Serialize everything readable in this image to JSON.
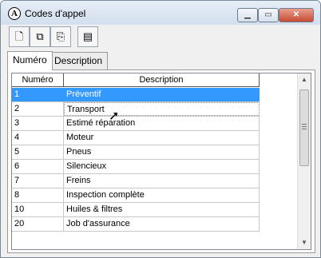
{
  "window": {
    "title": "Codes d'appel",
    "app_icon_letter": "A",
    "min_icon": "minimize-icon",
    "max_icon": "maximize-icon",
    "close_icon": "close-icon"
  },
  "toolbar": {
    "buttons": [
      {
        "icon": "new-document-icon"
      },
      {
        "icon": "copy-window-icon"
      },
      {
        "icon": "open-record-icon"
      },
      {
        "icon": "properties-icon"
      }
    ]
  },
  "tabs": [
    "Numéro",
    "Description"
  ],
  "table": {
    "headers": [
      "Numéro",
      "Description"
    ],
    "rows": [
      {
        "num": "1",
        "desc": "Préventif"
      },
      {
        "num": "2",
        "desc": "Transport"
      },
      {
        "num": "3",
        "desc": "Estimé réparation"
      },
      {
        "num": "4",
        "desc": "Moteur"
      },
      {
        "num": "5",
        "desc": "Pneus"
      },
      {
        "num": "6",
        "desc": "Silencieux"
      },
      {
        "num": "7",
        "desc": "Freins"
      },
      {
        "num": "8",
        "desc": "Inspection complète"
      },
      {
        "num": "10",
        "desc": "Huiles & filtres"
      },
      {
        "num": "20",
        "desc": "Job d'assurance"
      }
    ],
    "selected_row": 0
  },
  "colors": {
    "selection": "#3399ff",
    "close_button": "#c74a32"
  }
}
